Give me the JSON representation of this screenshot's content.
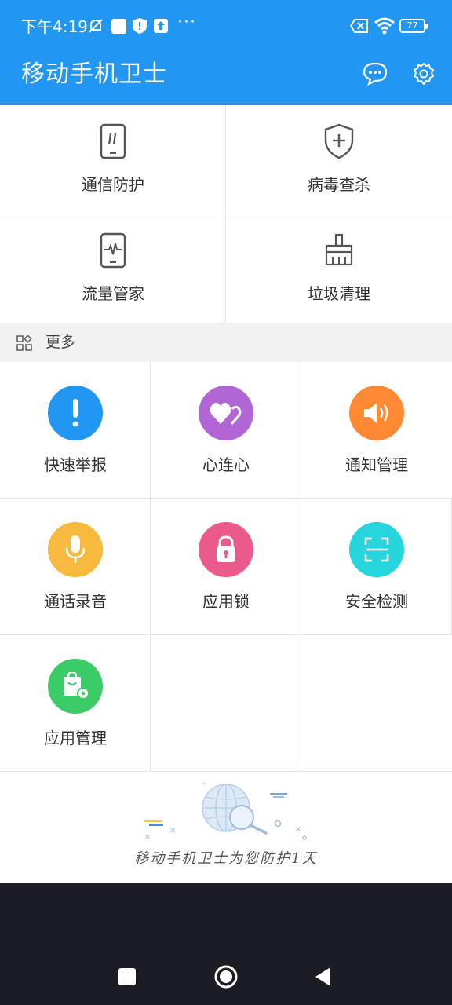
{
  "status_bar": {
    "time": "下午4:19",
    "more": "···",
    "battery": "77"
  },
  "app_bar": {
    "title": "移动手机卫士",
    "icons": [
      "message-icon",
      "settings-gear-icon"
    ]
  },
  "features": [
    {
      "label": "通信防护",
      "icon": "phone-shield-icon"
    },
    {
      "label": "病毒查杀",
      "icon": "shield-plus-icon"
    },
    {
      "label": "流量管家",
      "icon": "phone-pulse-icon"
    },
    {
      "label": "垃圾清理",
      "icon": "broom-icon"
    }
  ],
  "more_section": {
    "label": "更多",
    "icon": "grid-apps-icon"
  },
  "tools": [
    {
      "label": "快速举报",
      "icon": "exclamation-icon",
      "color": "#2196f3"
    },
    {
      "label": "心连心",
      "icon": "hearts-icon",
      "color": "#b266d6"
    },
    {
      "label": "通知管理",
      "icon": "speaker-icon",
      "color": "#ff8a33"
    },
    {
      "label": "通话录音",
      "icon": "microphone-icon",
      "color": "#f7b93e"
    },
    {
      "label": "应用锁",
      "icon": "lock-icon",
      "color": "#ea5b8c"
    },
    {
      "label": "安全检测",
      "icon": "scan-icon",
      "color": "#27d5dd"
    },
    {
      "label": "应用管理",
      "icon": "app-manage-icon",
      "color": "#3ccc67"
    }
  ],
  "banner": {
    "slogan": "移动手机卫士为您防护1天"
  },
  "nav": {
    "buttons": [
      "recents-button",
      "home-button",
      "back-button"
    ]
  }
}
